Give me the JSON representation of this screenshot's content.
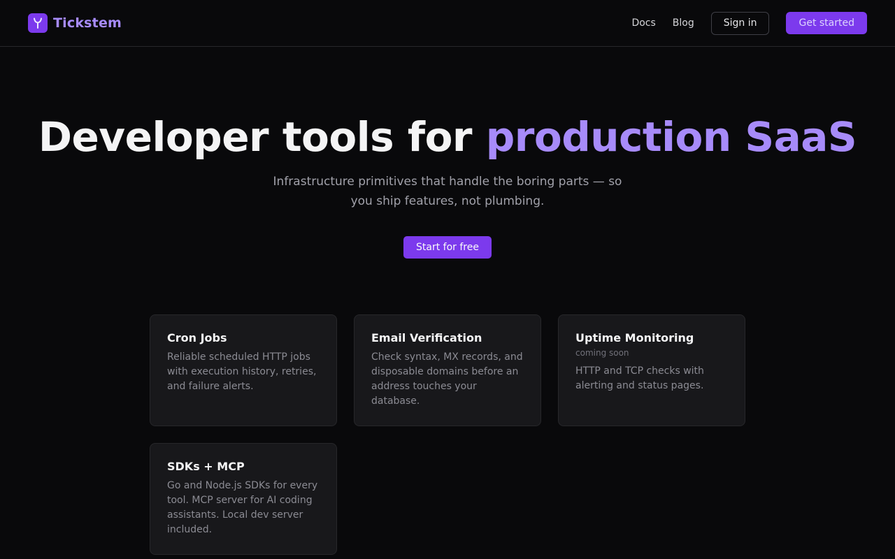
{
  "header": {
    "brand": "Tickstem",
    "nav": [
      "Docs",
      "Blog"
    ],
    "sign_in": "Sign in",
    "get_started": "Get started"
  },
  "hero": {
    "title_main": "Developer tools for ",
    "title_accent": "production SaaS",
    "subtitle": "Infrastructure primitives that handle the boring parts — so you ship features, not plumbing.",
    "cta": "Start for free"
  },
  "cards": [
    {
      "title": "Cron Jobs",
      "tag": "",
      "desc": "Reliable scheduled HTTP jobs with execution history, retries, and failure alerts."
    },
    {
      "title": "Email Verification",
      "tag": "",
      "desc": "Check syntax, MX records, and disposable domains before an address touches your database."
    },
    {
      "title": "Uptime Monitoring",
      "tag": "coming soon",
      "desc": "HTTP and TCP checks with alerting and status pages."
    },
    {
      "title": "SDKs + MCP",
      "tag": "",
      "desc": "Go and Node.js SDKs for every tool. MCP server for AI coding assistants. Local dev server included."
    }
  ],
  "colors": {
    "background": "#09090b",
    "accent": "#a78bfa",
    "primary": "#7c3aed",
    "card": "#18181b"
  },
  "icons": {
    "logo": "tickstem-logo-icon"
  }
}
